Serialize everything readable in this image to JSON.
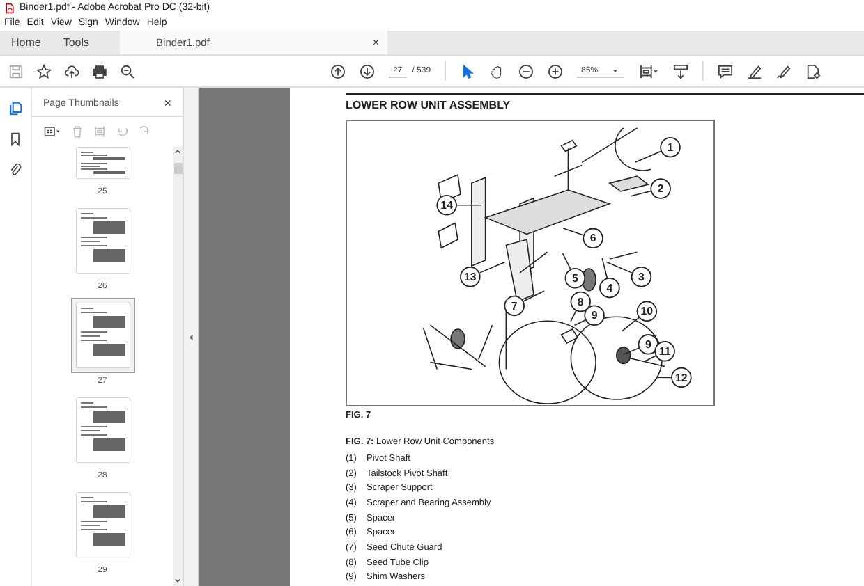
{
  "window": {
    "title": "Binder1.pdf - Adobe Acrobat Pro DC (32-bit)"
  },
  "menu": [
    "File",
    "Edit",
    "View",
    "Sign",
    "Window",
    "Help"
  ],
  "tabs": [
    {
      "label": "Home",
      "selected": false,
      "kind": "nav"
    },
    {
      "label": "Tools",
      "selected": false,
      "kind": "nav"
    },
    {
      "label": "Binder1.pdf",
      "selected": true,
      "kind": "document",
      "close": "×"
    }
  ],
  "toolbar": {
    "page": "27",
    "page_count": "/ 539",
    "zoom": "85%",
    "tools": [
      {
        "kind": "select",
        "selected": true
      },
      {
        "kind": "hand",
        "selected": false
      }
    ]
  },
  "side_panel": {
    "title": "Page Thumbnails",
    "close": "×",
    "thumbnails": [
      {
        "label": "25",
        "selected": false,
        "kind": "cut"
      },
      {
        "label": "26",
        "selected": false,
        "kind": "page"
      },
      {
        "label": "27",
        "selected": true,
        "kind": "page"
      },
      {
        "label": "28",
        "selected": false,
        "kind": "page"
      },
      {
        "label": "29",
        "selected": false,
        "kind": "page"
      }
    ]
  },
  "document": {
    "heading": "LOWER ROW UNIT ASSEMBLY",
    "callouts": [
      "1",
      "2",
      "14",
      "6",
      "13",
      "5",
      "4",
      "3",
      "7",
      "8",
      "9",
      "10",
      "9",
      "11",
      "12"
    ],
    "caption": "FIG. 7",
    "list_title": "**FIG. 7:** Lower Row Unit Components",
    "items": [
      {
        "number": "(1)",
        "text": "Pivot Shaft"
      },
      {
        "number": "(2)",
        "text": "Tailstock Pivot Shaft"
      },
      {
        "number": "(3)",
        "text": "Scraper Support"
      },
      {
        "number": "(4)",
        "text": "Scraper and Bearing Assembly"
      },
      {
        "number": "(5)",
        "text": "Spacer"
      },
      {
        "number": "(6)",
        "text": "Spacer"
      },
      {
        "number": "(7)",
        "text": "Seed Chute Guard"
      },
      {
        "number": "(8)",
        "text": "Seed Tube Clip"
      },
      {
        "number": "(9)",
        "text": "Shim Washers"
      }
    ]
  }
}
